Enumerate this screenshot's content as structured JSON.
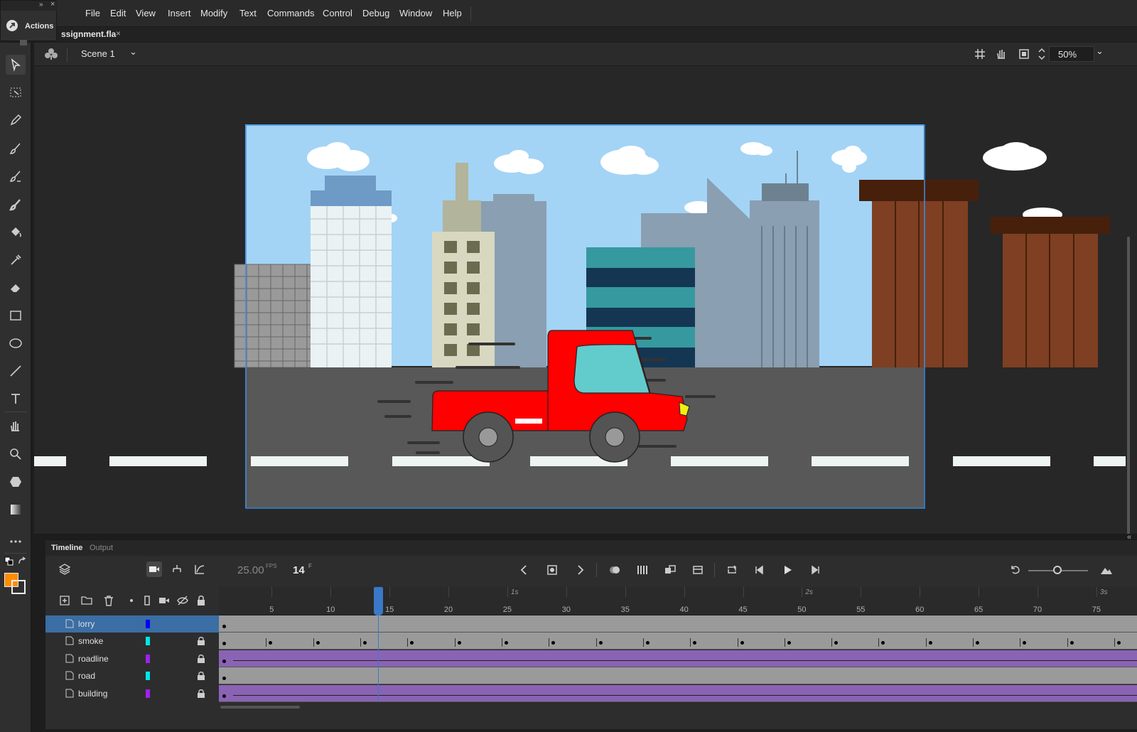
{
  "menu": {
    "items": [
      "File",
      "Edit",
      "View",
      "Insert",
      "Modify",
      "Text",
      "Commands",
      "Control",
      "Debug",
      "Window",
      "Help"
    ]
  },
  "actions_panel": {
    "label": "Actions"
  },
  "document_tab": {
    "label": "ssignment.fla"
  },
  "editbar": {
    "scene_label": "Scene 1",
    "zoom": "50%"
  },
  "tools": [
    "selection-tool",
    "free-transform-tool",
    "pencil-tool",
    "brush-tool",
    "paint-brush-tool",
    "fluid-brush-tool",
    "paint-bucket-tool",
    "eyedropper-tool",
    "eraser-tool",
    "rectangle-tool",
    "oval-tool",
    "line-tool",
    "text-tool",
    "hand-tool",
    "zoom-tool",
    "polystar-tool",
    "gradient-tool",
    "more-tools"
  ],
  "colors": {
    "stroke": "#000000",
    "fill": "#ff8c00",
    "accent": "#3a6ea5",
    "sky": "#a3d4f5",
    "road": "#555555",
    "truck": "#ff0000",
    "truck_window": "#62cccc",
    "playhead": "#3a78c8",
    "purple_track": "#8a63b5"
  },
  "timeline": {
    "tabs": [
      "Timeline",
      "Output"
    ],
    "fps": "25.00",
    "fps_unit": "FPS",
    "frame": "14",
    "frame_unit": "F",
    "ruler_ticks": [
      "5",
      "10",
      "15",
      "20",
      "25",
      "30",
      "35",
      "40",
      "45",
      "50",
      "55",
      "60",
      "65",
      "70",
      "75"
    ],
    "seconds": [
      "1s",
      "2s",
      "3s"
    ],
    "current_frame": 14,
    "layers": [
      {
        "name": "lorry",
        "color": "#0000ff",
        "locked": false,
        "selected": true
      },
      {
        "name": "smoke",
        "color": "#00e5e5",
        "locked": true,
        "selected": false
      },
      {
        "name": "roadline",
        "color": "#a020f0",
        "locked": true,
        "selected": false
      },
      {
        "name": "road",
        "color": "#00e5e5",
        "locked": true,
        "selected": false
      },
      {
        "name": "building",
        "color": "#a020f0",
        "locked": true,
        "selected": false
      }
    ]
  }
}
